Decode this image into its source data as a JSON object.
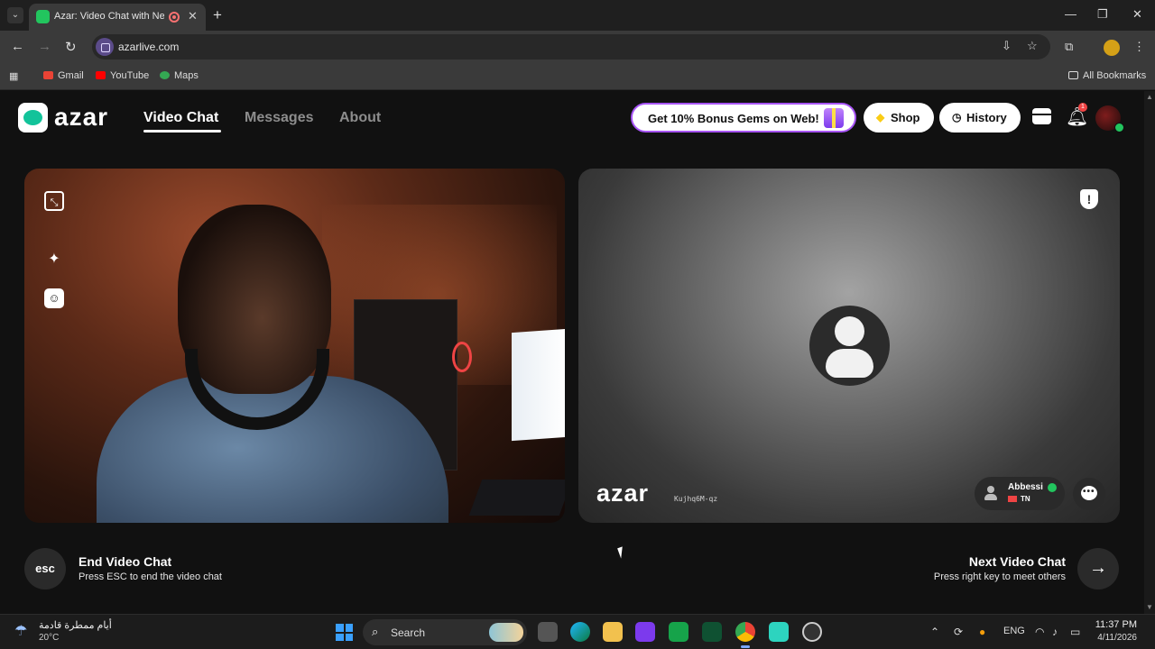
{
  "browser": {
    "tab_title": "Azar: Video Chat with New",
    "tab_close": "✕",
    "new_tab": "+",
    "url": "azarlive.com",
    "bookmarks": [
      "Gmail",
      "YouTube",
      "Maps"
    ],
    "all_bookmarks": "All Bookmarks",
    "window_controls": {
      "minimize": "—",
      "maximize": "❐",
      "close": "✕"
    }
  },
  "header": {
    "logo_text": "azar",
    "nav": [
      {
        "label": "Video Chat",
        "active": true
      },
      {
        "label": "Messages",
        "active": false
      },
      {
        "label": "About",
        "active": false
      }
    ],
    "promo_label": "Get 10% Bonus Gems on Web!",
    "shop_label": "Shop",
    "history_label": "History",
    "notification_count": "1",
    "accent_color": "#a855f7"
  },
  "partner": {
    "watermark": "azar",
    "watermark_id": "Kujhq6M-qz",
    "name": "Abbessi",
    "country": "TN"
  },
  "controls": {
    "esc_label": "esc",
    "end_title": "End Video Chat",
    "end_subtitle": "Press ESC to end the video chat",
    "next_title": "Next Video Chat",
    "next_subtitle": "Press right key to meet others",
    "next_arrow": "→"
  },
  "taskbar": {
    "weather_text": "أيام ممطرة قادمة",
    "temperature": "20°C",
    "search_label": "Search",
    "language": "ENG",
    "time": "11:37 PM",
    "date": "4/11/2026"
  }
}
